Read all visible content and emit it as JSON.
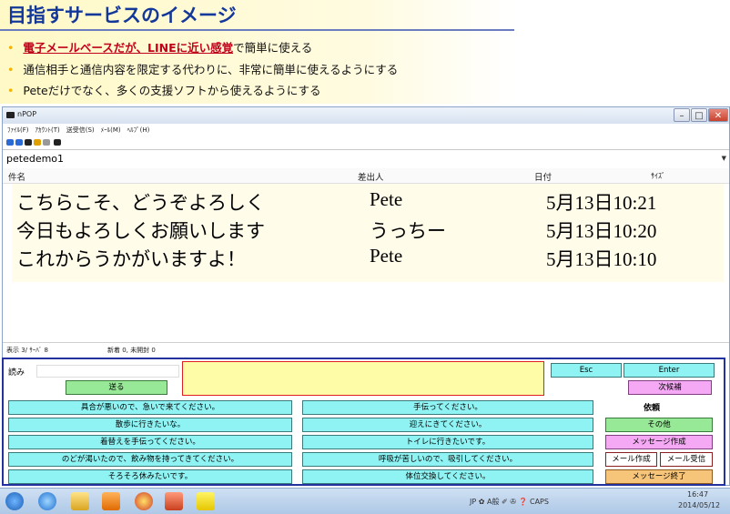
{
  "slide": {
    "title": "目指すサービスのイメージ",
    "bullet1_highlight": "電子メールベースだが、LINEに近い感覚",
    "bullet1_rest": "で簡単に使える",
    "bullet2": "通信相手と通信内容を限定する代わりに、非常に簡単に使えるようにする",
    "bullet3": "Peteだけでなく、多くの支援ソフトから使えるようにする",
    "bullet_symbol": "•"
  },
  "window": {
    "title": "nPOP",
    "menu": [
      "ﾌｧｲﾙ(F)",
      "ｱｶｳﾝﾄ(T)",
      "送受信(S)",
      "ﾒｰﾙ(M)",
      "ﾍﾙﾌﾟ(H)"
    ],
    "account": "petedemo1",
    "columns": {
      "subject": "件名",
      "from": "差出人",
      "date": "日付",
      "size": "ｻｲｽﾞ"
    },
    "mails": [
      {
        "subject": "こちらこそ、どうぞよろしく",
        "from": "Pete",
        "date": "5月13日10:21"
      },
      {
        "subject": "今日もよろしくお願いします",
        "from": "うっちー",
        "date": "5月13日10:20"
      },
      {
        "subject": "これからうかがいますよ！",
        "from": "Pete",
        "date": "5月13日10:10"
      }
    ],
    "status_left": "表示 3/ ｻｰﾊﾞ 8",
    "status_right": "新着 0, 未開封 0",
    "buttons": {
      "minimize": "–",
      "maximize": "□",
      "close": "✕"
    }
  },
  "panel": {
    "read_label": "読み",
    "send": "送る",
    "esc": "Esc",
    "enter": "Enter",
    "next_candidate": "次候補",
    "col1": [
      "具合が悪いので、急いで来てください。",
      "散歩に行きたいな。",
      "着替えを手伝ってください。",
      "のどが渇いたので、飲み物を持ってきてください。",
      "そろそろ休みたいです。"
    ],
    "col2": [
      "手伝ってください。",
      "迎えにきてください。",
      "トイレに行きたいです。",
      "呼吸が苦しいので、吸引してください。",
      "体位交換してください。"
    ],
    "irai": "依頼",
    "sonota": "その他",
    "message_create": "メッセージ作成",
    "mail_create": "メール作成",
    "mail_receive": "メール受信",
    "message_end": "メッセージ終了"
  },
  "taskbar": {
    "tray": "JP ✿ A般 ✐ ✇ ❓ CAPS",
    "time": "16:47",
    "date": "2014/05/12"
  },
  "colors": {
    "title_blue": "#13389a",
    "highlight_red": "#c0001a",
    "panel_border": "#2432a0",
    "cyan_button": "#8ff3f3",
    "green_button": "#97e897",
    "pink_button": "#f5a9f5",
    "orange_button": "#f7c57a"
  }
}
